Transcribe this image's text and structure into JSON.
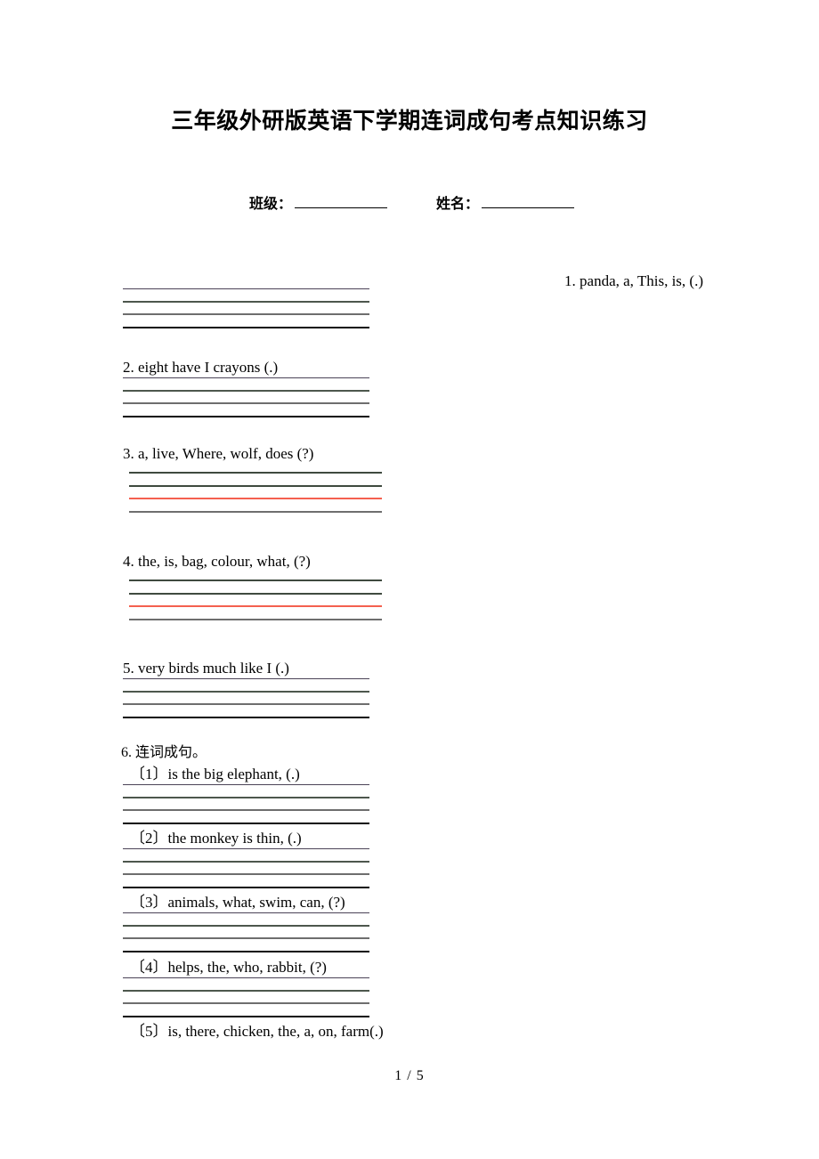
{
  "document": {
    "title": "三年级外研版英语下学期连词成句考点知识练习",
    "footer": "1 / 5"
  },
  "identity": {
    "class_label": "班级：",
    "name_label": "姓名："
  },
  "questions": [
    {
      "number": "1",
      "text": "1. panda, a, This, is, (.)",
      "align": "right",
      "line_count": 4,
      "has_red_line": false
    },
    {
      "number": "2",
      "text": "2. eight  have  I  crayons (.)",
      "align": "left",
      "line_count": 4,
      "has_red_line": false
    },
    {
      "number": "3",
      "text": "3. a, live, Where, wolf, does (?)",
      "align": "left",
      "line_count": 4,
      "has_red_line": true
    },
    {
      "number": "4",
      "text": "4. the, is, bag, colour, what, (?)",
      "align": "left",
      "line_count": 4,
      "has_red_line": true
    },
    {
      "number": "5",
      "text": "5. very  birds  much  like  I (.)",
      "align": "left",
      "line_count": 4,
      "has_red_line": false
    },
    {
      "number": "6",
      "text": "6. 连词成句。",
      "align": "left",
      "line_count": 0,
      "has_red_line": false,
      "sub_items": [
        {
          "marker": "〔1〕",
          "text": "〔1〕is the big elephant, (.)",
          "line_count": 4
        },
        {
          "marker": "〔2〕",
          "text": "〔2〕the monkey is thin, (.)",
          "line_count": 4
        },
        {
          "marker": "〔3〕",
          "text": "〔3〕animals, what, swim, can, (?)",
          "line_count": 4
        },
        {
          "marker": "〔4〕",
          "text": "〔4〕helps, the, who, rabbit, (?)",
          "line_count": 4
        },
        {
          "marker": "〔5〕",
          "text": "〔5〕is, there, chicken, the, a, on, farm(.)",
          "line_count": 0
        }
      ]
    }
  ],
  "colors": {
    "red_line": "#f4604f",
    "text": "#000000",
    "background": "#ffffff"
  }
}
